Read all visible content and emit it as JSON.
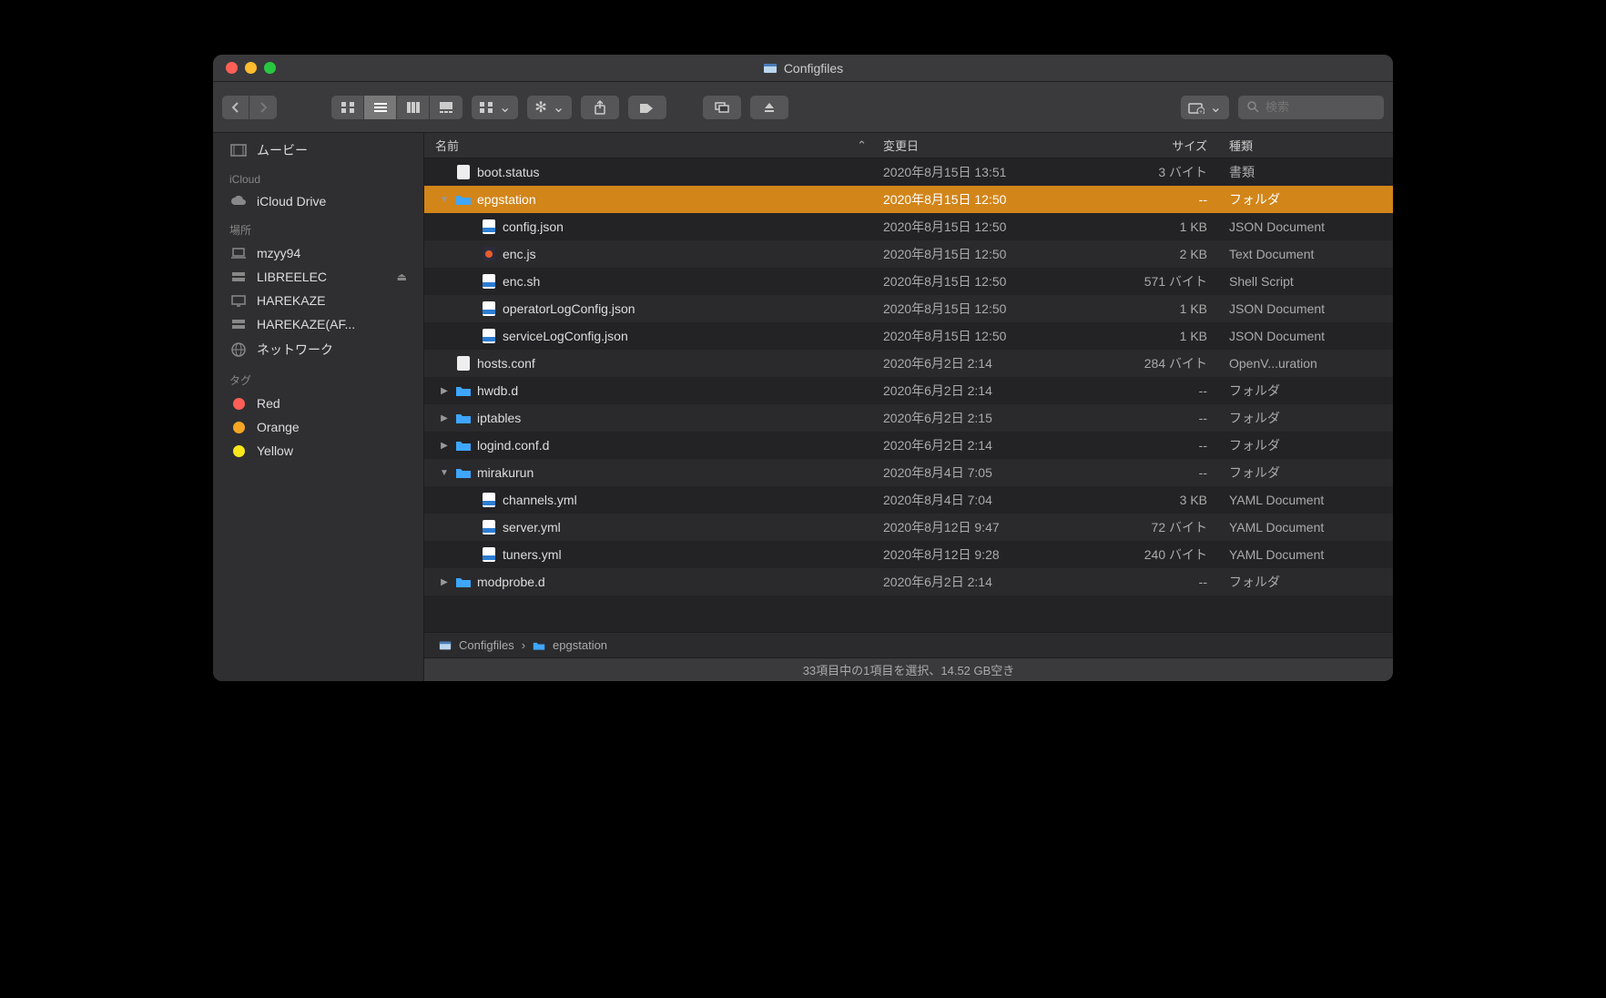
{
  "window": {
    "title": "Configfiles"
  },
  "toolbar": {
    "search_placeholder": "検索"
  },
  "sidebar": {
    "top_item": {
      "label": "ムービー"
    },
    "sections": [
      {
        "header": "iCloud",
        "items": [
          {
            "label": "iCloud Drive",
            "icon": "cloud"
          }
        ]
      },
      {
        "header": "場所",
        "items": [
          {
            "label": "mzyy94",
            "icon": "laptop"
          },
          {
            "label": "LIBREELEC",
            "icon": "server",
            "eject": true
          },
          {
            "label": "HAREKAZE",
            "icon": "display"
          },
          {
            "label": "HAREKAZE(AF...",
            "icon": "server"
          },
          {
            "label": "ネットワーク",
            "icon": "globe"
          }
        ]
      },
      {
        "header": "タグ",
        "items": [
          {
            "label": "Red",
            "icon": "tag",
            "color": "#ff5f57"
          },
          {
            "label": "Orange",
            "icon": "tag",
            "color": "#f5a623"
          },
          {
            "label": "Yellow",
            "icon": "tag",
            "color": "#f8e71c"
          }
        ]
      }
    ]
  },
  "columns": {
    "name": "名前",
    "modified": "変更日",
    "size": "サイズ",
    "kind": "種類"
  },
  "files": [
    {
      "indent": 0,
      "disc": "",
      "icon": "doc",
      "name": "boot.status",
      "date": "2020年8月15日 13:51",
      "size": "3 バイト",
      "kind": "書類"
    },
    {
      "indent": 0,
      "disc": "▼",
      "icon": "folder",
      "name": "epgstation",
      "date": "2020年8月15日 12:50",
      "size": "--",
      "kind": "フォルダ",
      "selected": true
    },
    {
      "indent": 1,
      "disc": "",
      "icon": "json",
      "name": "config.json",
      "date": "2020年8月15日 12:50",
      "size": "1 KB",
      "kind": "JSON Document"
    },
    {
      "indent": 1,
      "disc": "",
      "icon": "js",
      "name": "enc.js",
      "date": "2020年8月15日 12:50",
      "size": "2 KB",
      "kind": "Text Document"
    },
    {
      "indent": 1,
      "disc": "",
      "icon": "sh",
      "name": "enc.sh",
      "date": "2020年8月15日 12:50",
      "size": "571 バイト",
      "kind": "Shell Script"
    },
    {
      "indent": 1,
      "disc": "",
      "icon": "json",
      "name": "operatorLogConfig.json",
      "date": "2020年8月15日 12:50",
      "size": "1 KB",
      "kind": "JSON Document"
    },
    {
      "indent": 1,
      "disc": "",
      "icon": "json",
      "name": "serviceLogConfig.json",
      "date": "2020年8月15日 12:50",
      "size": "1 KB",
      "kind": "JSON Document"
    },
    {
      "indent": 0,
      "disc": "",
      "icon": "doc",
      "name": "hosts.conf",
      "date": "2020年6月2日 2:14",
      "size": "284 バイト",
      "kind": "OpenV...uration"
    },
    {
      "indent": 0,
      "disc": "▶",
      "icon": "folder",
      "name": "hwdb.d",
      "date": "2020年6月2日 2:14",
      "size": "--",
      "kind": "フォルダ"
    },
    {
      "indent": 0,
      "disc": "▶",
      "icon": "folder",
      "name": "iptables",
      "date": "2020年6月2日 2:15",
      "size": "--",
      "kind": "フォルダ"
    },
    {
      "indent": 0,
      "disc": "▶",
      "icon": "folder",
      "name": "logind.conf.d",
      "date": "2020年6月2日 2:14",
      "size": "--",
      "kind": "フォルダ"
    },
    {
      "indent": 0,
      "disc": "▼",
      "icon": "folder",
      "name": "mirakurun",
      "date": "2020年8月4日 7:05",
      "size": "--",
      "kind": "フォルダ"
    },
    {
      "indent": 1,
      "disc": "",
      "icon": "yml",
      "name": "channels.yml",
      "date": "2020年8月4日 7:04",
      "size": "3 KB",
      "kind": "YAML Document"
    },
    {
      "indent": 1,
      "disc": "",
      "icon": "yml",
      "name": "server.yml",
      "date": "2020年8月12日 9:47",
      "size": "72 バイト",
      "kind": "YAML Document"
    },
    {
      "indent": 1,
      "disc": "",
      "icon": "yml",
      "name": "tuners.yml",
      "date": "2020年8月12日 9:28",
      "size": "240 バイト",
      "kind": "YAML Document"
    },
    {
      "indent": 0,
      "disc": "▶",
      "icon": "folder",
      "name": "modprobe.d",
      "date": "2020年6月2日 2:14",
      "size": "--",
      "kind": "フォルダ"
    }
  ],
  "pathbar": [
    "Configfiles",
    "epgstation"
  ],
  "status": "33項目中の1項目を選択、14.52 GB空き"
}
